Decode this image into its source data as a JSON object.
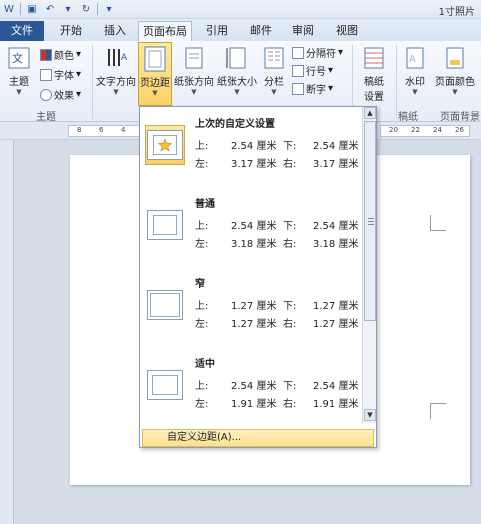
{
  "title_bar": {
    "doc_title": "1寸照片"
  },
  "tabs": {
    "file": "文件",
    "items": [
      "开始",
      "插入",
      "页面布局",
      "引用",
      "邮件",
      "审阅",
      "视图"
    ]
  },
  "ribbon": {
    "theme": {
      "label": "主题",
      "colors": "颜色",
      "fonts": "字体",
      "effects": "效果",
      "group": "主题"
    },
    "text_direction": "文字方向",
    "margins": "页边距",
    "orientation": "纸张方向",
    "size": "纸张大小",
    "columns": "分栏",
    "breaks": "分隔符",
    "line_numbers": "行号",
    "hyphenation": "断字",
    "stationery": {
      "line1": "稿纸",
      "line2": "设置",
      "group": "稿纸"
    },
    "watermark": "水印",
    "page_color": "页面颜色",
    "page_background_group": "页面背景"
  },
  "ruler": {
    "left_ticks": [
      "8",
      "6",
      "4"
    ],
    "right_ticks": [
      "20",
      "22",
      "24",
      "26"
    ]
  },
  "margins_menu": {
    "options": [
      {
        "name": "上次的自定义设置",
        "top_label": "上:",
        "top": "2.54 厘米",
        "bottom_label": "下:",
        "bottom": "2.54 厘米",
        "left_label": "左:",
        "left": "3.17 厘米",
        "right_label": "右:",
        "right": "3.17 厘米"
      },
      {
        "name": "普通",
        "top_label": "上:",
        "top": "2.54 厘米",
        "bottom_label": "下:",
        "bottom": "2.54 厘米",
        "left_label": "左:",
        "left": "3.18 厘米",
        "right_label": "右:",
        "right": "3.18 厘米"
      },
      {
        "name": "窄",
        "top_label": "上:",
        "top": "1.27 厘米",
        "bottom_label": "下:",
        "bottom": "1.27 厘米",
        "left_label": "左:",
        "left": "1.27 厘米",
        "right_label": "右:",
        "right": "1.27 厘米"
      },
      {
        "name": "适中",
        "top_label": "上:",
        "top": "2.54 厘米",
        "bottom_label": "下:",
        "bottom": "2.54 厘米",
        "left_label": "左:",
        "left": "1.91 厘米",
        "right_label": "右:",
        "right": "1.91 厘米"
      }
    ],
    "custom_margins": "自定义边距(A)..."
  }
}
